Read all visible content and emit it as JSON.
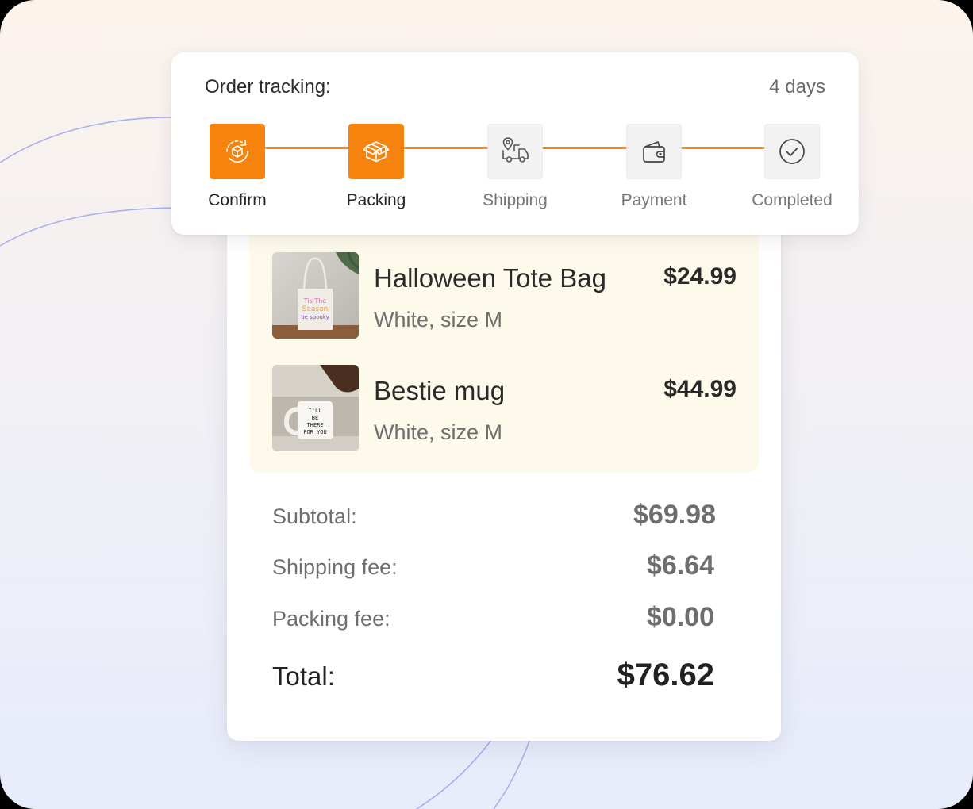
{
  "tracking": {
    "title": "Order tracking:",
    "duration": "4 days",
    "accent_color": "#f5830e",
    "current_step": 2,
    "steps": [
      {
        "label": "Confirm",
        "icon": "refresh-cube-icon",
        "active": true
      },
      {
        "label": "Packing",
        "icon": "box-icon",
        "active": true
      },
      {
        "label": "Shipping",
        "icon": "delivery-truck-icon",
        "active": false
      },
      {
        "label": "Payment",
        "icon": "wallet-icon",
        "active": false
      },
      {
        "label": "Completed",
        "icon": "check-circle-icon",
        "active": false
      }
    ]
  },
  "order": {
    "items": [
      {
        "name": "Halloween Tote Bag",
        "variant": "White, size M",
        "price": "$24.99",
        "image": "tote-bag-photo"
      },
      {
        "name": "Bestie mug",
        "variant": "White, size M",
        "price": "$44.99",
        "image": "mug-photo"
      }
    ],
    "summary": {
      "subtotal_label": "Subtotal:",
      "subtotal": "$69.98",
      "shipping_label": "Shipping fee:",
      "shipping": "$6.64",
      "packing_label": "Packing fee:",
      "packing": "$0.00",
      "total_label": "Total:",
      "total": "$76.62"
    }
  }
}
